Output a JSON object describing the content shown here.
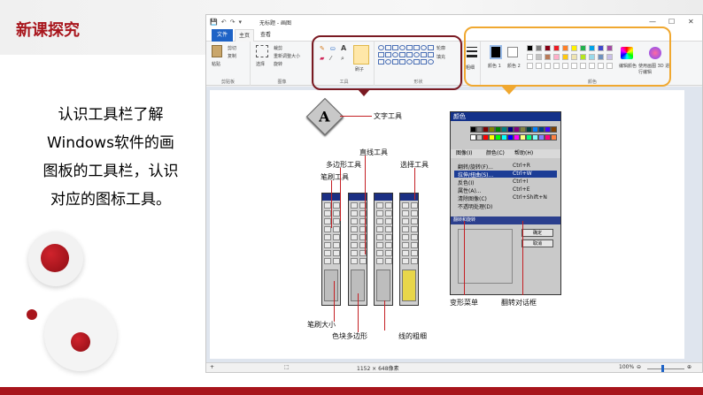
{
  "slide": {
    "title": "新课探究",
    "lines": [
      "认识工具栏了解",
      "Windows软件的画",
      "图板的工具栏，认识",
      "对应的图标工具。"
    ]
  },
  "paint": {
    "window_title": "无标题 - 画图",
    "quick_access": [
      "💾",
      "↶",
      "↷",
      "▾"
    ],
    "tabs": {
      "file": "文件",
      "home": "主页",
      "view": "查看"
    },
    "clipboard": {
      "paste": "粘贴",
      "cut": "剪切",
      "copy": "复制",
      "group": "剪贴板"
    },
    "image": {
      "select": "选择",
      "crop": "裁剪",
      "resize": "重新调整大小",
      "rotate": "旋转",
      "group": "图像"
    },
    "tools": {
      "brush": "刷子",
      "group": "工具"
    },
    "shapes": {
      "outline": "轮廓",
      "fill": "填充",
      "group": "形状"
    },
    "size": {
      "label": "粗细"
    },
    "colors": {
      "color1": "颜色 1",
      "color2": "颜色 2",
      "edit": "编辑颜色",
      "paint3d": "使用画图 3D 进行编辑",
      "group": "颜色"
    },
    "status": {
      "dimensions": "1152 × 648像素",
      "zoom": "100%"
    }
  },
  "annotations": {
    "text_tool": "文字工具",
    "line_tool": "直线工具",
    "polygon_tool": "多边形工具",
    "brush_tool": "笔刷工具",
    "select_tool": "选择工具",
    "brush_size": "笔刷大小",
    "color_polygon": "色块多边形",
    "line_width": "线的粗细",
    "transform_menu": "变形菜单",
    "flip_dialog": "翻转对话框"
  },
  "menu": {
    "title": "颜色",
    "bar": [
      "图像(I)",
      "颜色(C)",
      "帮助(H)"
    ],
    "items": [
      {
        "label": "翻转/旋转(F)...",
        "key": "Ctrl+R"
      },
      {
        "label": "拉伸/扭曲(S)...",
        "key": "Ctrl+W"
      },
      {
        "label": "反色(I)",
        "key": "Ctrl+I"
      },
      {
        "label": "属性(A)...",
        "key": "Ctrl+E"
      },
      {
        "label": "清除图像(C)",
        "key": "Ctrl+Shift+N"
      },
      {
        "label": "不透明处理(D)",
        "key": ""
      }
    ],
    "dialog_title": "翻转和旋转",
    "dialog_ok": "确定",
    "dialog_cancel": "取消"
  },
  "colors": {
    "accent": "#a8151c",
    "ribbon_file": "#1e63c6",
    "highlight_tools": "#7a1a22",
    "highlight_colors": "#f0a830"
  }
}
